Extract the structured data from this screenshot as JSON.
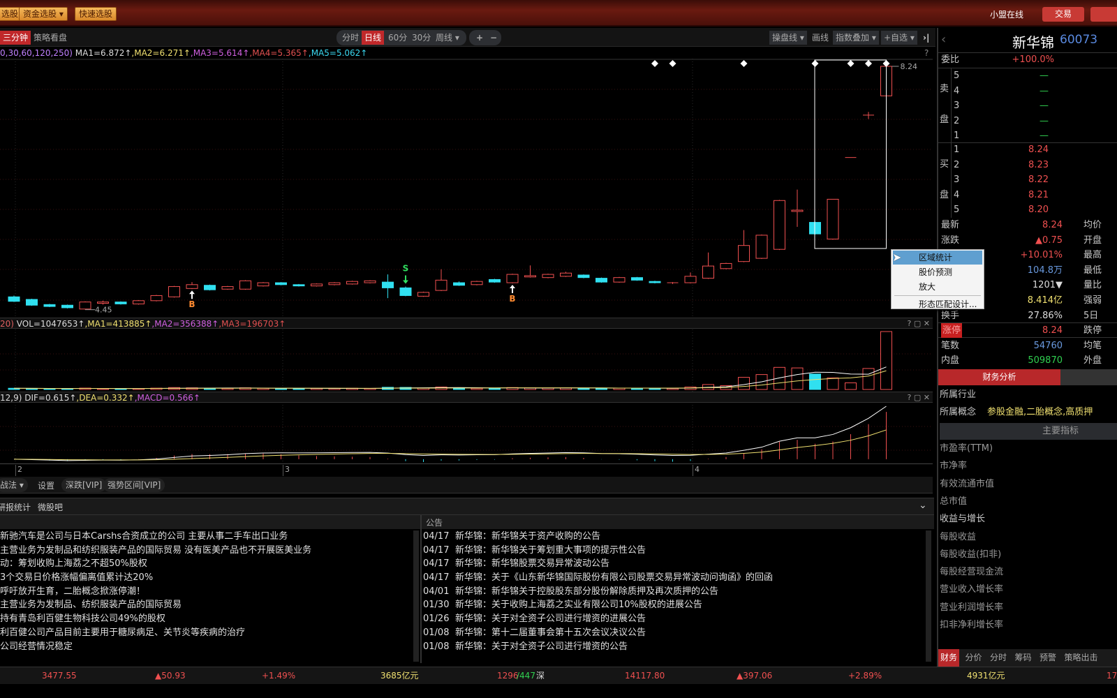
{
  "topbar": {
    "buttons": [
      "选股",
      "资金选股",
      "快速选股"
    ],
    "status": "小盟在线",
    "trade": "交易"
  },
  "toolbar": {
    "left": [
      "三分钟",
      "策略看盘"
    ],
    "periods": [
      "分时",
      "日线",
      "60分",
      "30分",
      "周线"
    ],
    "active_period": "日线",
    "zoom_in": "+",
    "zoom_out": "−",
    "right": [
      "操盘线",
      "画线",
      "指数叠加",
      "+自选"
    ],
    "collapse": "›|",
    "help": "?"
  },
  "ma": {
    "params": "0,30,60,120,250)",
    "ma1": "MA1=6.872↑",
    "ma2": ",MA2=6.271↑",
    "ma3": ",MA3=5.614↑",
    "ma4": ",MA4=5.365↑",
    "ma5": ",MA5=5.062↑"
  },
  "vol_header": {
    "params": "20)",
    "vol": "VOL=1047653↑",
    "ma1": ",MA1=413885↑",
    "ma2": ",MA2=356388↑",
    "ma3": ",MA3=196703↑"
  },
  "macd_header": {
    "params": "12,9)",
    "dif": "DIF=0.615↑",
    "dea": ",DEA=0.332↑",
    "macd": ",MACD=0.566↑"
  },
  "chart_data": {
    "type": "candlestick",
    "high_label": "8.24",
    "low_label": "4.45",
    "ohlc": [
      [
        4.65,
        4.67,
        4.57,
        4.58
      ],
      [
        4.61,
        4.62,
        4.51,
        4.52
      ],
      [
        4.53,
        4.54,
        4.49,
        4.5
      ],
      [
        4.52,
        4.53,
        4.47,
        4.48
      ],
      [
        4.46,
        4.58,
        4.45,
        4.57
      ],
      [
        4.55,
        4.59,
        4.53,
        4.57
      ],
      [
        4.57,
        4.58,
        4.53,
        4.54
      ],
      [
        4.54,
        4.6,
        4.53,
        4.59
      ],
      [
        4.59,
        4.68,
        4.58,
        4.67
      ],
      [
        4.65,
        4.82,
        4.64,
        4.81
      ],
      [
        4.78,
        4.88,
        4.77,
        4.84
      ],
      [
        4.83,
        4.84,
        4.75,
        4.76
      ],
      [
        4.77,
        4.82,
        4.76,
        4.81
      ],
      [
        4.77,
        4.91,
        4.76,
        4.9
      ],
      [
        4.82,
        4.88,
        4.81,
        4.87
      ],
      [
        4.87,
        4.88,
        4.83,
        4.84
      ],
      [
        4.84,
        4.85,
        4.81,
        4.82
      ],
      [
        4.82,
        4.86,
        4.81,
        4.85
      ],
      [
        4.84,
        4.88,
        4.83,
        4.87
      ],
      [
        4.85,
        4.9,
        4.84,
        4.89
      ],
      [
        4.87,
        4.91,
        4.86,
        4.9
      ],
      [
        4.88,
        5.0,
        4.63,
        4.79
      ],
      [
        4.79,
        4.81,
        4.66,
        4.67
      ],
      [
        4.66,
        4.73,
        4.65,
        4.72
      ],
      [
        4.75,
        5.08,
        4.74,
        4.91
      ],
      [
        4.87,
        4.89,
        4.82,
        4.83
      ],
      [
        4.84,
        4.9,
        4.83,
        4.89
      ],
      [
        4.92,
        4.93,
        4.87,
        4.88
      ],
      [
        4.87,
        5.01,
        4.86,
        5.0
      ],
      [
        4.96,
        5.14,
        4.95,
        4.98
      ],
      [
        4.95,
        5.01,
        4.94,
        5.0
      ],
      [
        4.97,
        5.04,
        4.96,
        5.02
      ],
      [
        4.99,
        5.0,
        4.94,
        4.95
      ],
      [
        4.94,
        4.95,
        4.87,
        4.88
      ],
      [
        4.88,
        4.96,
        4.87,
        4.95
      ],
      [
        4.95,
        4.96,
        4.9,
        4.91
      ],
      [
        4.89,
        4.9,
        4.86,
        4.87
      ],
      [
        4.86,
        4.88,
        4.85,
        4.87
      ],
      [
        4.87,
        5.03,
        4.86,
        4.97
      ],
      [
        4.94,
        5.34,
        4.93,
        5.13
      ],
      [
        5.09,
        5.18,
        5.08,
        5.17
      ],
      [
        5.2,
        5.69,
        5.19,
        5.45
      ],
      [
        5.25,
        5.62,
        5.24,
        5.61
      ],
      [
        5.39,
        6.16,
        5.38,
        6.15
      ],
      [
        5.98,
        6.32,
        5.74,
        6.0
      ],
      [
        5.81,
        5.82,
        5.62,
        5.63
      ],
      [
        5.55,
        6.17,
        5.54,
        6.17
      ],
      [
        6.82,
        6.82,
        6.82,
        6.82
      ],
      [
        7.48,
        7.53,
        7.42,
        7.48
      ],
      [
        7.78,
        8.24,
        7.78,
        8.24
      ]
    ],
    "volume": [
      22000,
      20000,
      15000,
      14000,
      25000,
      16000,
      15000,
      18000,
      24000,
      35000,
      30000,
      22000,
      20000,
      30000,
      22000,
      18000,
      17000,
      19000,
      20000,
      22000,
      20000,
      40000,
      38000,
      26000,
      45000,
      24000,
      22000,
      20000,
      35000,
      30000,
      26000,
      28000,
      25000,
      26000,
      24000,
      22000,
      18000,
      20000,
      45000,
      90000,
      70000,
      220000,
      270000,
      400000,
      390000,
      280000,
      210000,
      120000,
      380000,
      1047653
    ],
    "signals": [
      {
        "index": 10,
        "type": "B"
      },
      {
        "index": 22,
        "type": "S"
      },
      {
        "index": 28,
        "type": "B"
      }
    ],
    "markers": [
      36,
      37,
      41,
      45,
      47,
      48,
      49
    ],
    "selection": {
      "from": 45,
      "to": 49
    },
    "x_ticks": [
      {
        "index": 0,
        "label": "2"
      },
      {
        "index": 15,
        "label": "3"
      },
      {
        "index": 38,
        "label": "4"
      }
    ],
    "colors": {
      "up": "#f05050",
      "down": "#30e0f0"
    }
  },
  "strategy_bar": {
    "items": [
      "战法",
      "设置",
      "深跌[VIP]",
      "强势区间[VIP]"
    ]
  },
  "bottom_tabs": [
    "研报统计",
    "微股吧"
  ],
  "announce_title": "公告",
  "news_left": [
    "新驰汽车是公司与日本Carshs合资成立的公司 主要从事二手车出口业务",
    "主营业务为发制品和纺织服装产品的国际贸易 没有医美产品也不开展医美业务",
    "动：筹划收购上海荔之不超50%股权",
    "3个交易日价格涨幅偏离值累计达20%",
    "呼吁放开生育，二胎概念掀涨停潮！",
    "主营业务为发制品、纺织服装产品的国际贸易",
    "持有青岛利百健生物科技公司49%的股权",
    "利百健公司产品目前主要用于糖尿病足、关节炎等疾病的治疗",
    "公司经营情况稳定"
  ],
  "announcements": [
    {
      "date": "04/17",
      "text": "新华锦：新华锦关于资产收购的公告"
    },
    {
      "date": "04/17",
      "text": "新华锦：新华锦关于筹划重大事项的提示性公告"
    },
    {
      "date": "04/17",
      "text": "新华锦：新华锦股票交易异常波动公告"
    },
    {
      "date": "04/17",
      "text": "新华锦：关于《山东新华锦国际股份有限公司股票交易异常波动问询函》的回函"
    },
    {
      "date": "04/01",
      "text": "新华锦：新华锦关于控股股东部分股份解除质押及再次质押的公告"
    },
    {
      "date": "01/30",
      "text": "新华锦：关于收购上海荔之实业有限公司10%股权的进展公告"
    },
    {
      "date": "01/26",
      "text": "新华锦：关于对全资子公司进行增资的进展公告"
    },
    {
      "date": "01/08",
      "text": "新华锦：第十二届董事会第十五次会议决议公告"
    },
    {
      "date": "01/08",
      "text": "新华锦：关于对全资子公司进行增资的公告"
    }
  ],
  "context_menu": [
    "区域统计",
    "股价预测",
    "放大",
    "形态匹配设计..."
  ],
  "quote": {
    "name": "新华锦",
    "code": "60073",
    "weibi_label": "委比",
    "weibi": "+100.0%",
    "sell_label": [
      "卖",
      "盘"
    ],
    "buy_label": [
      "买",
      "盘"
    ],
    "sell": [
      {
        "n": "5",
        "p": "—"
      },
      {
        "n": "4",
        "p": "—"
      },
      {
        "n": "3",
        "p": "—"
      },
      {
        "n": "2",
        "p": "—"
      },
      {
        "n": "1",
        "p": "—"
      }
    ],
    "buy": [
      {
        "n": "1",
        "p": "8.24"
      },
      {
        "n": "2",
        "p": "8.23"
      },
      {
        "n": "3",
        "p": "8.22"
      },
      {
        "n": "4",
        "p": "8.21"
      },
      {
        "n": "5",
        "p": "8.20"
      }
    ],
    "stats": [
      {
        "l": "最新",
        "v": "8.24",
        "r": "均价",
        "c": "red"
      },
      {
        "l": "涨跌",
        "v": "▲0.75",
        "r": "开盘",
        "c": "red"
      },
      {
        "l": "",
        "v": "+10.01%",
        "r": "最高",
        "c": "red"
      },
      {
        "l": "",
        "v": "104.8万",
        "r": "最低",
        "c": "blue"
      },
      {
        "l": "",
        "v": "1201▼",
        "r": "量比",
        "c": "white"
      },
      {
        "l": "",
        "v": "8.414亿",
        "r": "强弱",
        "c": "yellow"
      },
      {
        "l": "换手",
        "v": "27.86%",
        "r": "5日",
        "c": "white"
      },
      {
        "l": "涨停",
        "v": "8.24",
        "r": "跌停",
        "c": "red"
      },
      {
        "l": "笔数",
        "v": "54760",
        "r": "均笔",
        "c": "blue"
      },
      {
        "l": "内盘",
        "v": "509870",
        "r": "外盘",
        "c": "green"
      }
    ]
  },
  "finance": {
    "tab": "财务分析",
    "industry_label": "所属行业",
    "concept_label": "所属概念",
    "concept": "参股金融,二胎概念,高质押",
    "section": "主要指标",
    "items": [
      "市盈率(TTM)",
      "市净率",
      "有效流通市值",
      "总市值",
      "收益与增长",
      "每股收益",
      "每股收益(扣非)",
      "每股经营现金流",
      "营业收入增长率",
      "营业利润增长率",
      "扣非净利增长率"
    ],
    "tabs": [
      "财务",
      "分价",
      "分时",
      "筹码",
      "预警",
      "策略出击"
    ]
  },
  "statusbar": {
    "sh_index": "3477.55",
    "sh_change": "▲50.93",
    "sh_pct": "+1.49%",
    "sh_amount": "3685亿元",
    "sh_updown_up": "1296",
    "sh_updown_down": "/447",
    "sz_label": "深",
    "sz_index": "14117.80",
    "sz_change": "▲397.06",
    "sz_pct": "+2.89%",
    "sz_amount": "4931亿元",
    "cut": "17"
  }
}
